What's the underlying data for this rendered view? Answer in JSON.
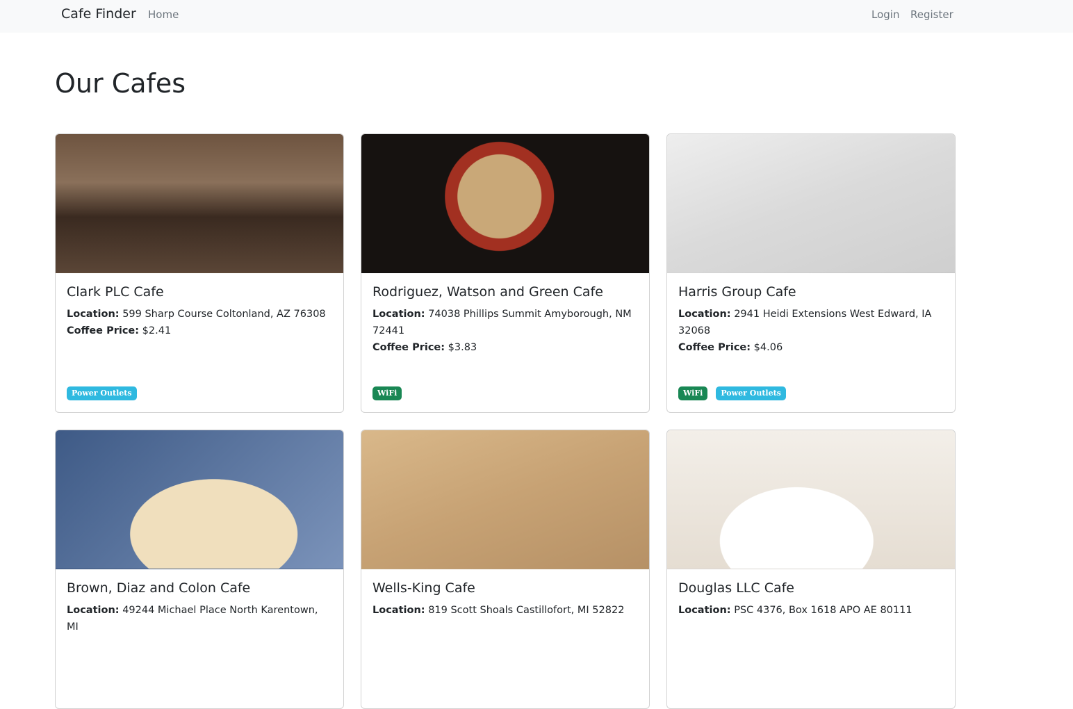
{
  "navbar": {
    "brand": "Cafe Finder",
    "home": "Home",
    "login": "Login",
    "register": "Register"
  },
  "page": {
    "title": "Our Cafes"
  },
  "labels": {
    "location": "Location:",
    "price": "Coffee Price:"
  },
  "cafes": [
    {
      "name": "Clark PLC Cafe",
      "location": "599 Sharp Course Coltonland, AZ 76308",
      "price": "$2.41",
      "badges": [
        "Power Outlets"
      ]
    },
    {
      "name": "Rodriguez, Watson and Green Cafe",
      "location": "74038 Phillips Summit Amyborough, NM 72441",
      "price": "$3.83",
      "badges": [
        "WiFi"
      ]
    },
    {
      "name": "Harris Group Cafe",
      "location": "2941 Heidi Extensions West Edward, IA 32068",
      "price": "$4.06",
      "badges": [
        "WiFi",
        "Power Outlets"
      ]
    },
    {
      "name": "Brown, Diaz and Colon Cafe",
      "location": "49244 Michael Place North Karentown, MI",
      "price": "",
      "badges": []
    },
    {
      "name": "Wells-King Cafe",
      "location": "819 Scott Shoals Castillofort, MI 52822",
      "price": "",
      "badges": []
    },
    {
      "name": "Douglas LLC Cafe",
      "location": "PSC 4376, Box 1618 APO AE 80111",
      "price": "",
      "badges": []
    }
  ],
  "colors": {
    "wifi": "#198754",
    "power_outlets": "#2fb9e0"
  }
}
